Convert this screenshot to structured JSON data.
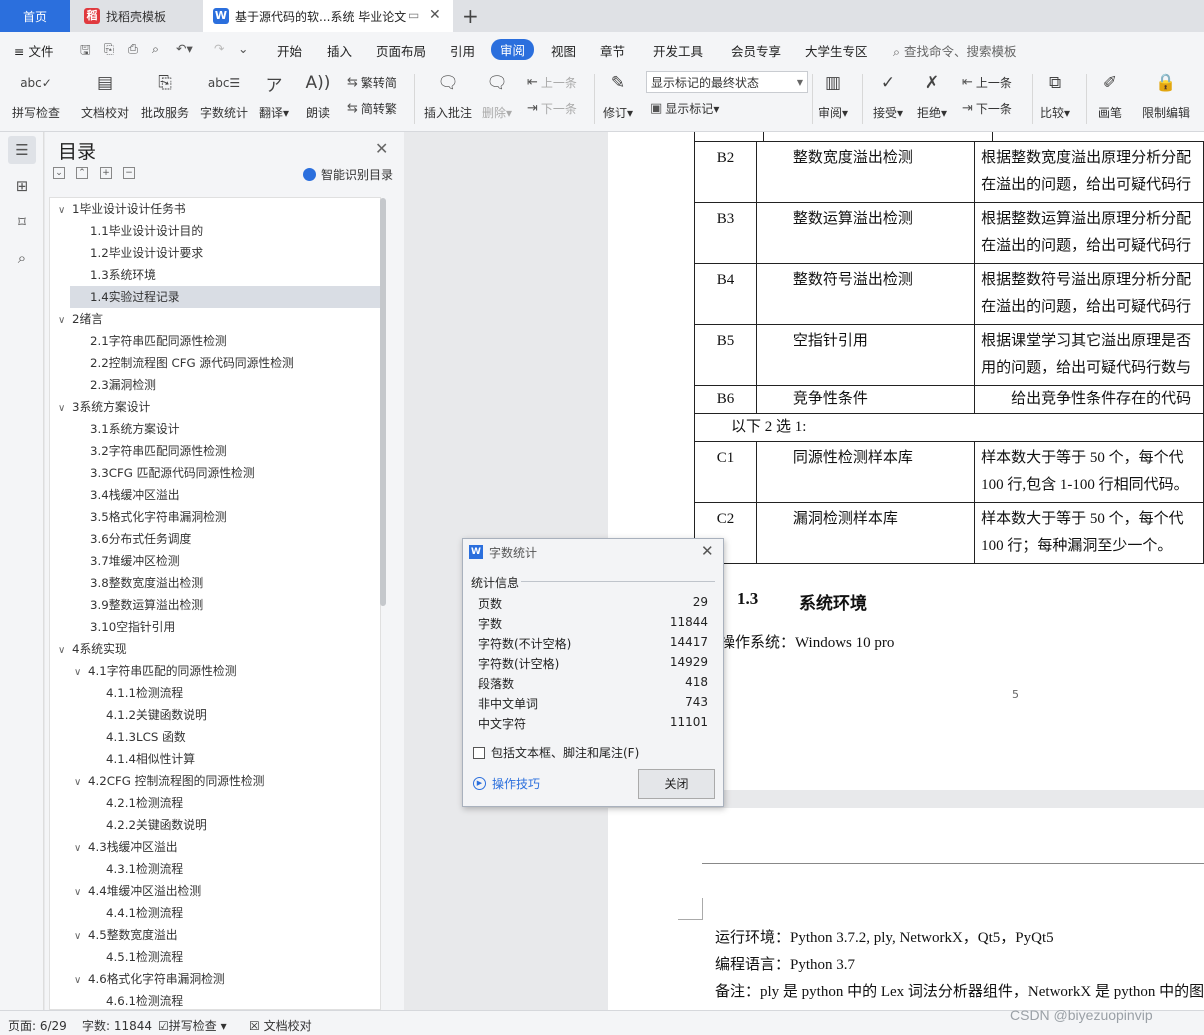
{
  "tabs": {
    "home": "首页",
    "template": "找稻壳模板",
    "document": "基于源代码的软...系统 毕业论文",
    "new_tab": "+"
  },
  "menu": {
    "file": "文件",
    "items": [
      "开始",
      "插入",
      "页面布局",
      "引用",
      "审阅",
      "视图",
      "章节",
      "开发工具",
      "会员专享",
      "大学生专区"
    ],
    "active": "审阅",
    "search": "查找命令、搜索模板"
  },
  "ribbon": {
    "spell_check": "拼写检查",
    "doc_check": "文档校对",
    "annotate": "批改服务",
    "word_count": "字数统计",
    "translate": "翻译",
    "read_aloud": "朗读",
    "to_traditional": "繁转简",
    "to_simplified": "简转繁",
    "insert_comment": "插入批注",
    "delete": "删除",
    "prev_comment": "上一条",
    "next_comment": "下一条",
    "revise": "修订",
    "markup_mode": "显示标记的最终状态",
    "show_markup": "显示标记",
    "review": "审阅",
    "accept": "接受",
    "reject": "拒绝",
    "prev_change": "上一条",
    "next_change": "下一条",
    "compare": "比较",
    "ink": "画笔",
    "restrict": "限制编辑"
  },
  "toc": {
    "title": "目录",
    "smart": "智能识别目录",
    "items": [
      {
        "label": "1毕业设计设计任务书",
        "level": 1
      },
      {
        "label": "1.1毕业设计设计目的",
        "level": 2
      },
      {
        "label": "1.2毕业设计设计要求",
        "level": 2
      },
      {
        "label": "1.3系统环境",
        "level": 2
      },
      {
        "label": "1.4实验过程记录",
        "level": 2,
        "selected": true
      },
      {
        "label": "2绪言",
        "level": 1
      },
      {
        "label": "2.1字符串匹配同源性检测",
        "level": 2
      },
      {
        "label": "2.2控制流程图 CFG 源代码同源性检测",
        "level": 2
      },
      {
        "label": "2.3漏洞检测",
        "level": 2
      },
      {
        "label": "3系统方案设计",
        "level": 1
      },
      {
        "label": "3.1系统方案设计",
        "level": 2
      },
      {
        "label": "3.2字符串匹配同源性检测",
        "level": 2
      },
      {
        "label": "3.3CFG 匹配源代码同源性检测",
        "level": 2
      },
      {
        "label": "3.4栈缓冲区溢出",
        "level": 2
      },
      {
        "label": "3.5格式化字符串漏洞检测",
        "level": 2
      },
      {
        "label": "3.6分布式任务调度",
        "level": 2
      },
      {
        "label": "3.7堆缓冲区检测",
        "level": 2
      },
      {
        "label": "3.8整数宽度溢出检测",
        "level": 2
      },
      {
        "label": "3.9整数运算溢出检测",
        "level": 2
      },
      {
        "label": "3.10空指针引用",
        "level": 2
      },
      {
        "label": "4系统实现",
        "level": 1
      },
      {
        "label": "4.1字符串匹配的同源性检测",
        "level": 2,
        "expandable": true
      },
      {
        "label": "4.1.1检测流程",
        "level": 3
      },
      {
        "label": "4.1.2关键函数说明",
        "level": 3
      },
      {
        "label": "4.1.3LCS 函数",
        "level": 3
      },
      {
        "label": "4.1.4相似性计算",
        "level": 3
      },
      {
        "label": "4.2CFG 控制流程图的同源性检测",
        "level": 2,
        "expandable": true
      },
      {
        "label": "4.2.1检测流程",
        "level": 3
      },
      {
        "label": "4.2.2关键函数说明",
        "level": 3
      },
      {
        "label": "4.3栈缓冲区溢出",
        "level": 2,
        "expandable": true
      },
      {
        "label": "4.3.1检测流程",
        "level": 3
      },
      {
        "label": "4.4堆缓冲区溢出检测",
        "level": 2,
        "expandable": true
      },
      {
        "label": "4.4.1检测流程",
        "level": 3
      },
      {
        "label": "4.5整数宽度溢出",
        "level": 2,
        "expandable": true
      },
      {
        "label": "4.5.1检测流程",
        "level": 3
      },
      {
        "label": "4.6格式化字符串漏洞检测",
        "level": 2,
        "expandable": true
      },
      {
        "label": "4.6.1检测流程",
        "level": 3
      }
    ]
  },
  "document": {
    "rows": [
      {
        "id": "B2",
        "name": "整数宽度溢出检测",
        "desc1": "根据整数宽度溢出原理分析分配",
        "desc2": "在溢出的问题，给出可疑代码行"
      },
      {
        "id": "B3",
        "name": "整数运算溢出检测",
        "desc1": "根据整数运算溢出原理分析分配",
        "desc2": "在溢出的问题，给出可疑代码行"
      },
      {
        "id": "B4",
        "name": "整数符号溢出检测",
        "desc1": "根据整数符号溢出原理分析分配",
        "desc2": "在溢出的问题，给出可疑代码行"
      },
      {
        "id": "B5",
        "name": "空指针引用",
        "desc1": "根据课堂学习其它溢出原理是否",
        "desc2": "用的问题，给出可疑代码行数与"
      },
      {
        "id": "B6",
        "name": "竞争性条件",
        "desc1": "给出竞争性条件存在的代码"
      },
      {
        "id": "C1",
        "name": "同源性检测样本库",
        "desc1": "样本数大于等于 50 个，每个代",
        "desc2": "100 行,包含 1-100 行相同代码。"
      },
      {
        "id": "C2",
        "name": "漏洞检测样本库",
        "desc1": "样本数大于等于 50 个，每个代",
        "desc2": "100 行；每种漏洞至少一个。"
      }
    ],
    "choose_row": "以下 2 选 1:",
    "section_num": "1.3",
    "section_title": "系统环境",
    "os_line": "操作系统：Windows 10 pro",
    "page_number": "5",
    "env_line": "运行环境：Python 3.7.2, ply, NetworkX，Qt5，PyQt5",
    "lang_line": "编程语言：Python 3.7",
    "note_line": "备注：ply 是 python 中的 Lex 词法分析器组件，NetworkX 是 python 中的图"
  },
  "dialog": {
    "title": "字数统计",
    "group": "统计信息",
    "stats": [
      {
        "label": "页数",
        "value": "29"
      },
      {
        "label": "字数",
        "value": "11844"
      },
      {
        "label": "字符数(不计空格)",
        "value": "14417"
      },
      {
        "label": "字符数(计空格)",
        "value": "14929"
      },
      {
        "label": "段落数",
        "value": "418"
      },
      {
        "label": "非中文单词",
        "value": "743"
      },
      {
        "label": "中文字符",
        "value": "11101"
      }
    ],
    "checkbox": "包括文本框、脚注和尾注(F)",
    "tips": "操作技巧",
    "close": "关闭"
  },
  "status": {
    "page": "页面: 6/29",
    "words": "字数: 11844",
    "spell": "拼写检查",
    "doc_check": "文档校对"
  },
  "watermark": "CSDN @biyezuopinvip"
}
